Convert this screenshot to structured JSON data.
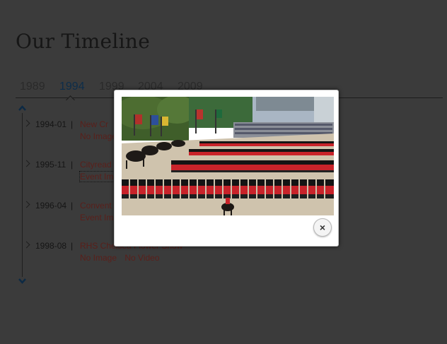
{
  "page": {
    "title": "Our Timeline"
  },
  "years": {
    "items": [
      {
        "label": "1989",
        "active": false
      },
      {
        "label": "1994",
        "active": true
      },
      {
        "label": "1999",
        "active": false
      },
      {
        "label": "2004",
        "active": false
      },
      {
        "label": "2009",
        "active": false
      }
    ]
  },
  "timeline": {
    "scroll_up_icon": "chevron-up-icon",
    "scroll_down_icon": "chevron-down-icon",
    "entries": [
      {
        "date": "1994-01",
        "separator": "|",
        "title": "New Cr",
        "image": "No Image",
        "video": ""
      },
      {
        "date": "1995-11",
        "separator": "|",
        "title": "Cityread",
        "image": "Event Ima",
        "video": ""
      },
      {
        "date": "1996-04",
        "separator": "|",
        "title": "Convent",
        "image": "Event Im",
        "video": ""
      },
      {
        "date": "1998-08",
        "separator": "|",
        "title": "RHS Chelsea Flower Show",
        "image": "No Image",
        "video": "No Video"
      }
    ]
  },
  "lightbox": {
    "close_label": "×",
    "close_icon": "close-icon"
  },
  "colors": {
    "background": "#3b3b3b",
    "active_year": "#0d2d4a",
    "entry_link": "#5a1f1a",
    "guard_red": "#c8232a"
  }
}
